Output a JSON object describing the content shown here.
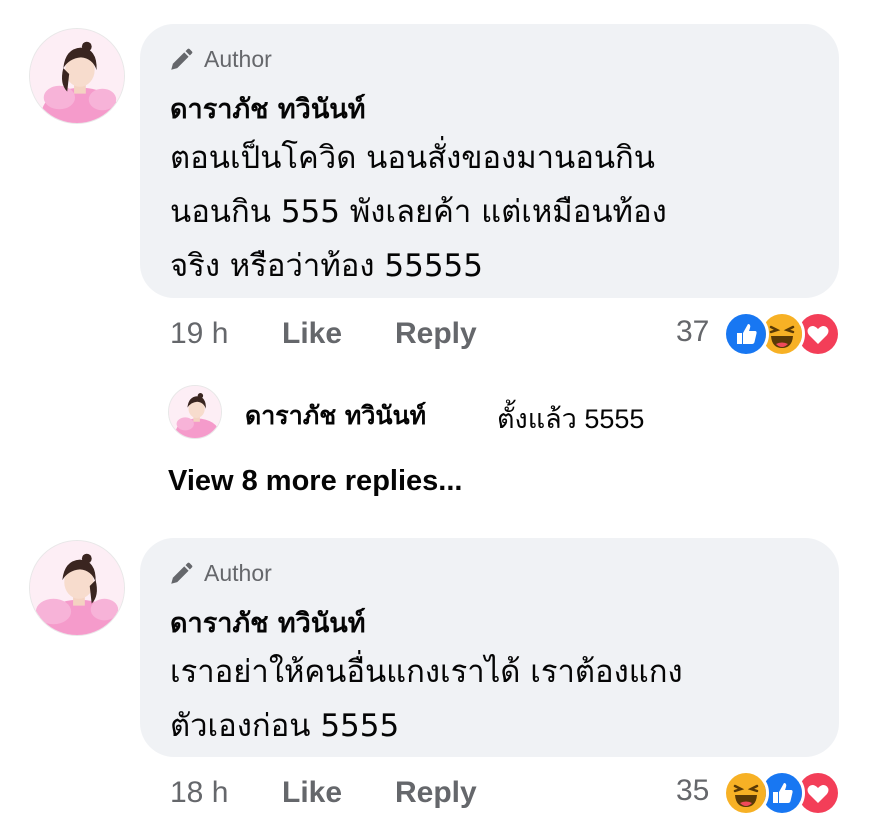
{
  "comments": [
    {
      "badge": "Author",
      "name": "ดาราภัช ทวินันท์",
      "lines": [
        "ตอนเป็นโควิด นอนสั่งของมานอนกิน",
        "นอนกิน 555 พังเลยค้า แต่เหมือนท้อง",
        "จริง หรือว่าท้อง 55555"
      ],
      "time": "19 h",
      "like_label": "Like",
      "reply_label": "Reply",
      "reaction_count": "37",
      "reactions": [
        "like-reaction-icon",
        "haha-reaction-icon",
        "love-reaction-icon"
      ],
      "reply_preview": {
        "name": "ดาราภัช ทวินันท์",
        "text": "ตั้งแล้ว 5555"
      },
      "view_more": "View 8 more replies..."
    },
    {
      "badge": "Author",
      "name": "ดาราภัช ทวินันท์",
      "lines": [
        "เราอย่าให้คนอื่นแกงเราได้ เราต้องแกง",
        "ตัวเองก่อน 5555"
      ],
      "time": "18 h",
      "like_label": "Like",
      "reply_label": "Reply",
      "reaction_count": "35",
      "reactions": [
        "haha-reaction-icon",
        "like-reaction-icon",
        "love-reaction-icon"
      ]
    }
  ],
  "colors": {
    "bubble": "#f0f2f5",
    "meta_text": "#65676b",
    "like_blue": "#1877f2",
    "haha_yellow": "#f7b125",
    "love_red": "#f33e58"
  }
}
